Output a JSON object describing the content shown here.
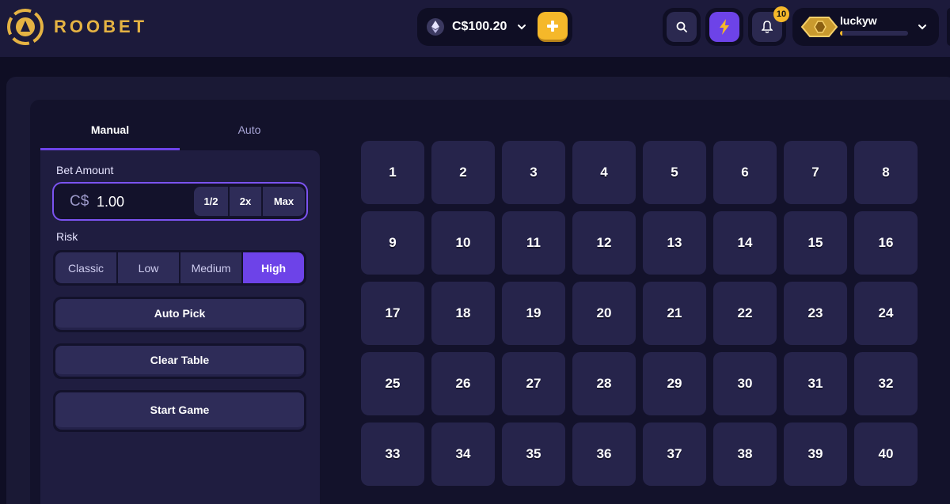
{
  "brand": {
    "name": "ROOBET",
    "accent": "#e5b343"
  },
  "wallet": {
    "balance": "C$100.20",
    "currency_icon": "ethereum-icon",
    "deposit_icon": "plus-icon"
  },
  "header_buttons": {
    "search_icon": "search-icon",
    "boost_icon": "lightning-icon",
    "notifications_icon": "bell-icon",
    "notification_count": "10"
  },
  "user": {
    "username": "luckyw",
    "xp_progress": 0.03
  },
  "game": {
    "tabs": [
      {
        "label": "Manual",
        "active": true
      },
      {
        "label": "Auto",
        "active": false
      }
    ],
    "bet": {
      "label": "Bet Amount",
      "currency": "C$",
      "amount": "1.00",
      "modifiers": [
        "1/2",
        "2x",
        "Max"
      ]
    },
    "risk": {
      "label": "Risk",
      "options": [
        "Classic",
        "Low",
        "Medium",
        "High"
      ],
      "selected": "High"
    },
    "buttons": {
      "auto_pick": "Auto Pick",
      "clear_table": "Clear Table",
      "start_game": "Start Game"
    },
    "numbers": [
      "1",
      "2",
      "3",
      "4",
      "5",
      "6",
      "7",
      "8",
      "9",
      "10",
      "11",
      "12",
      "13",
      "14",
      "15",
      "16",
      "17",
      "18",
      "19",
      "20",
      "21",
      "22",
      "23",
      "24",
      "25",
      "26",
      "27",
      "28",
      "29",
      "30",
      "31",
      "32",
      "33",
      "34",
      "35",
      "36",
      "37",
      "38",
      "39",
      "40"
    ]
  },
  "colors": {
    "primary": "#6d43e8",
    "gold": "#f5b82a",
    "background": "#0f0e24"
  }
}
